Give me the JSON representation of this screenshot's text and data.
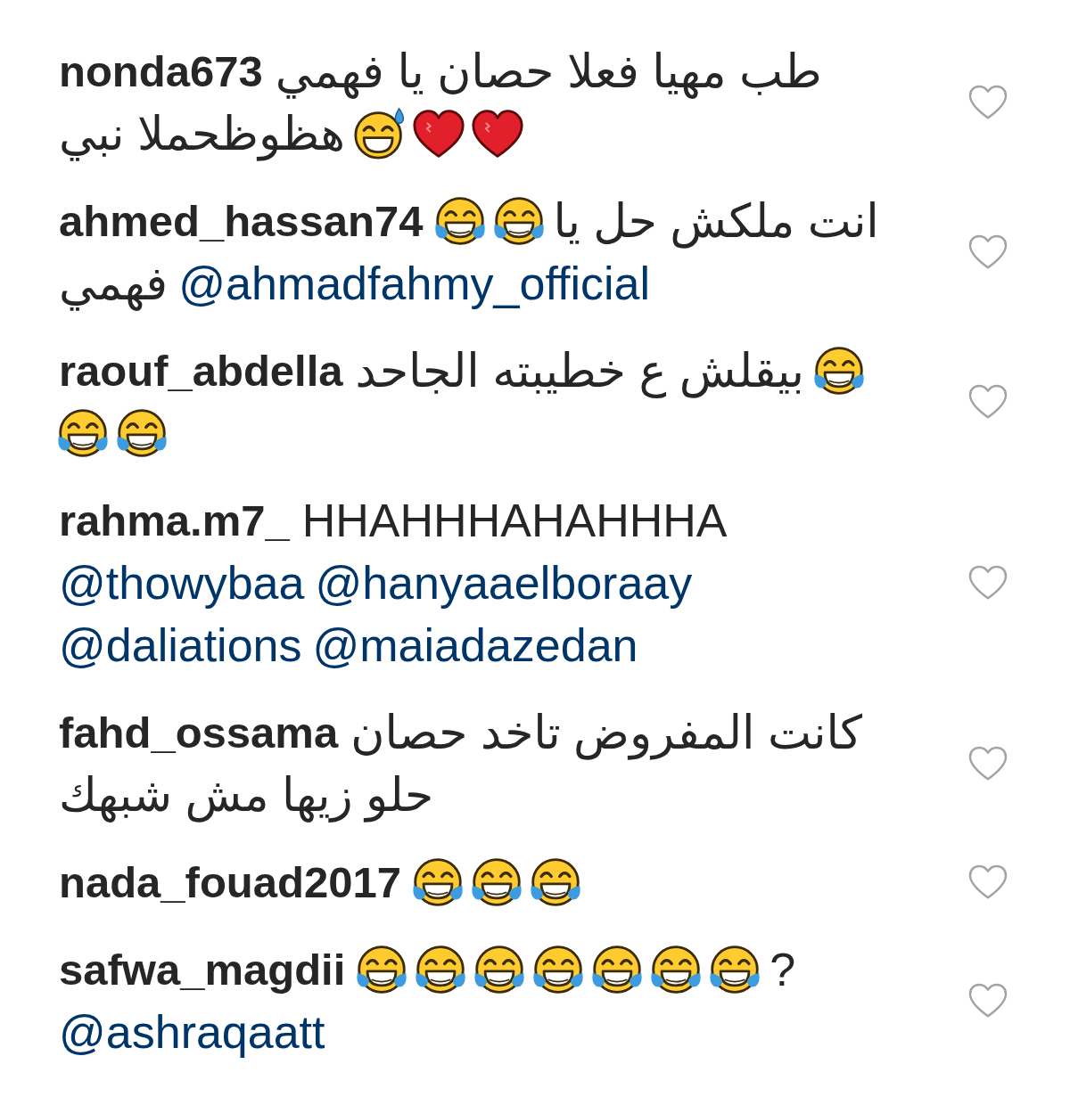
{
  "comments": [
    {
      "username": "nonda673",
      "liked": false,
      "lines": [
        [
          {
            "kind": "text",
            "text": "طب مهيا فعلا حصان يا فهمي"
          }
        ],
        [
          {
            "kind": "heart"
          },
          {
            "kind": "heart"
          },
          {
            "kind": "sweat_smile"
          },
          {
            "kind": "text",
            "text": "هظوظحملا نبي"
          }
        ]
      ]
    },
    {
      "username": "ahmed_hassan74",
      "liked": false,
      "lines": [
        [
          {
            "kind": "text",
            "text": "انت ملكش حل يا"
          },
          {
            "kind": "joy"
          },
          {
            "kind": "joy"
          }
        ],
        [
          {
            "kind": "mention",
            "text": "@ahmadfahmy_official"
          },
          {
            "kind": "text",
            "text": "فهمي"
          }
        ]
      ]
    },
    {
      "username": "raouf_abdella",
      "liked": false,
      "lines": [
        [
          {
            "kind": "joy"
          },
          {
            "kind": "text",
            "text": "بيقلش ع خطيبته الجاحد"
          }
        ],
        [
          {
            "kind": "joy"
          },
          {
            "kind": "joy"
          }
        ]
      ]
    },
    {
      "username": "rahma.m7_",
      "liked": false,
      "lines": [
        [
          {
            "kind": "text",
            "text": "HHAHHHAHAHHHA"
          }
        ],
        [
          {
            "kind": "mention",
            "text": "@hanyaaelboraay"
          },
          {
            "kind": "mention",
            "text": "@thowybaa"
          }
        ],
        [
          {
            "kind": "mention",
            "text": "@maiadazedan"
          },
          {
            "kind": "mention",
            "text": "@daliations"
          }
        ]
      ]
    },
    {
      "username": "fahd_ossama",
      "liked": false,
      "lines": [
        [
          {
            "kind": "text",
            "text": "كانت المفروض تاخد حصان"
          }
        ],
        [
          {
            "kind": "text",
            "text": "حلو زيها مش شبهك"
          }
        ]
      ]
    },
    {
      "username": "nada_fouad2017",
      "liked": false,
      "lines": [
        [
          {
            "kind": "joy"
          },
          {
            "kind": "joy"
          },
          {
            "kind": "joy"
          }
        ]
      ]
    },
    {
      "username": "safwa_magdii",
      "liked": false,
      "lines": [
        [
          {
            "kind": "text",
            "text": "?"
          },
          {
            "kind": "joy"
          },
          {
            "kind": "joy"
          },
          {
            "kind": "joy"
          },
          {
            "kind": "joy"
          },
          {
            "kind": "joy"
          },
          {
            "kind": "joy"
          },
          {
            "kind": "joy"
          }
        ],
        [
          {
            "kind": "mention",
            "text": "@ashraqaatt"
          }
        ]
      ]
    }
  ]
}
